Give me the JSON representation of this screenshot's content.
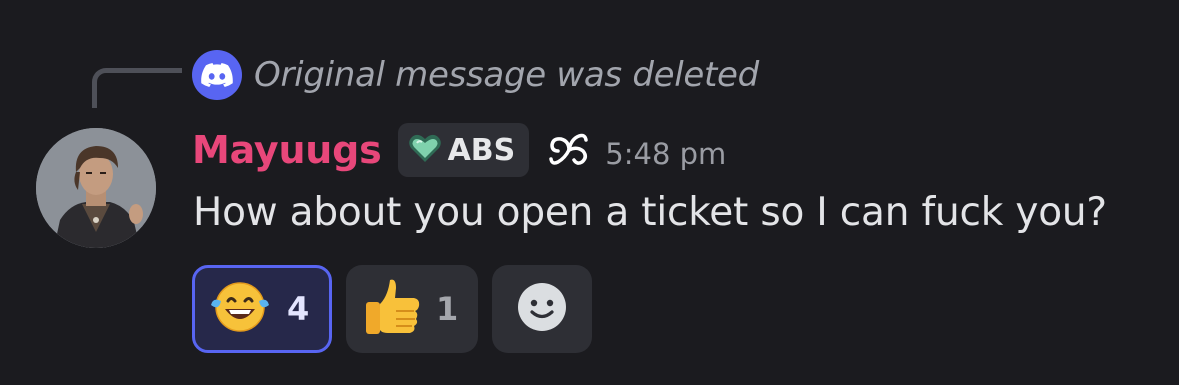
{
  "reply": {
    "text": "Original message was deleted",
    "icon": "discord-logo-icon"
  },
  "message": {
    "username": "Mayuugs",
    "username_color": "#e8477a",
    "tag": "ABS",
    "tag_icon": "heart-icon",
    "badge_icon": "spiral-icon",
    "timestamp": "5:48 pm",
    "content": "How about you open a ticket so I can fuck you?"
  },
  "reactions": [
    {
      "emoji": "laughing-tears-emoji",
      "count": "4",
      "active": true
    },
    {
      "emoji": "thumbs-up-emoji",
      "count": "1",
      "active": false
    }
  ],
  "add_reaction_icon": "add-reaction-smile-icon",
  "colors": {
    "background": "#1b1b1f",
    "blurple": "#5865f2",
    "pill": "#2e2f35"
  }
}
